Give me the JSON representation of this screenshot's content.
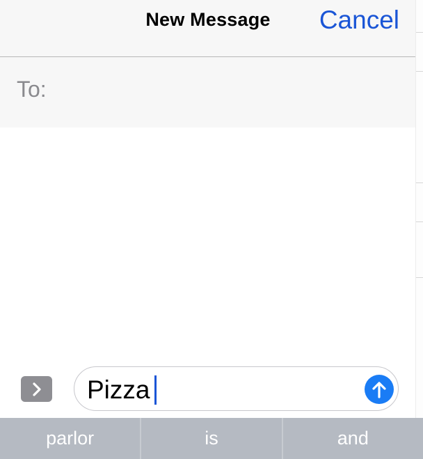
{
  "header": {
    "title": "New Message",
    "cancel_label": "Cancel"
  },
  "recipient": {
    "label": "To:",
    "value": ""
  },
  "composer": {
    "text": "Pizza"
  },
  "suggestions": [
    "parlor",
    "is",
    "and"
  ],
  "icons": {
    "expand": "chevron-right-icon",
    "send": "arrow-up-icon"
  },
  "colors": {
    "accent": "#1a55d6",
    "send": "#1a7cf5",
    "suggestion_bar": "#b5bac2"
  }
}
